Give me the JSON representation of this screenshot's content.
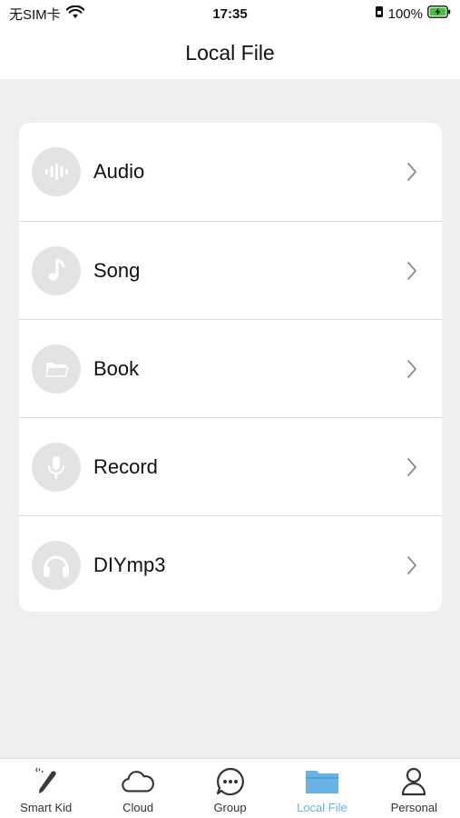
{
  "status_bar": {
    "carrier": "无SIM卡",
    "time": "17:35",
    "battery": "100%"
  },
  "header": {
    "title": "Local File"
  },
  "list": {
    "items": [
      {
        "label": "Audio",
        "icon": "waveform-icon"
      },
      {
        "label": "Song",
        "icon": "music-note-icon"
      },
      {
        "label": "Book",
        "icon": "folder-icon"
      },
      {
        "label": "Record",
        "icon": "microphone-icon"
      },
      {
        "label": "DIYmp3",
        "icon": "headphones-icon"
      }
    ]
  },
  "tabs": [
    {
      "label": "Smart Kid",
      "icon": "pen-icon",
      "active": false
    },
    {
      "label": "Cloud",
      "icon": "cloud-icon",
      "active": false
    },
    {
      "label": "Group",
      "icon": "chat-bubble-icon",
      "active": false
    },
    {
      "label": "Local File",
      "icon": "folder-icon",
      "active": true
    },
    {
      "label": "Personal",
      "icon": "person-icon",
      "active": false
    }
  ],
  "colors": {
    "accent": "#6ab2e6",
    "background": "#efefef",
    "icon_circle": "#e3e3e3",
    "icon_glyph": "#ffffff"
  }
}
